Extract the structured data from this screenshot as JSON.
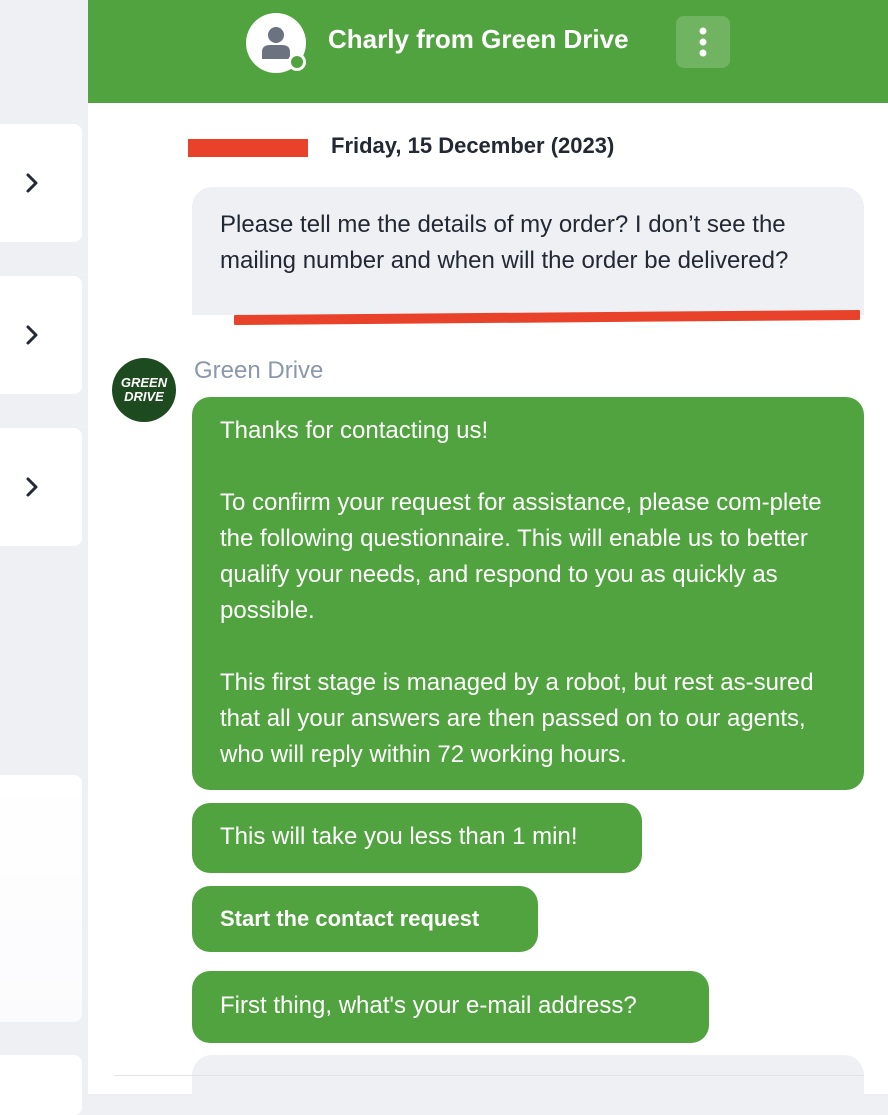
{
  "header": {
    "agent_title": "Charly from Green Drive",
    "brand_color": "#51a33f"
  },
  "conversation": {
    "date_label": "Friday, 15 December (2023)",
    "user_message": "Please tell me the details of my order? I don’t see the mailing number and when will the order be delivered?",
    "bot_name": "Green Drive",
    "bot_avatar_text": [
      "GREEN",
      "DRIVE"
    ],
    "bot_messages": {
      "intro_1": "Thanks for contacting us!",
      "intro_2": "To confirm your request for assistance, please com-plete the following questionnaire. This will enable us to better qualify your needs, and respond to you as quickly as possible.",
      "intro_3": "This first stage is managed by a robot, but rest as-sured that all your answers are then passed on to our agents, who will reply within 72 working hours.",
      "time_note": "This will take you less than 1 min!",
      "start_button": "Start the contact request",
      "email_question": "First thing, what's your e-mail address?"
    }
  },
  "annotations": {
    "arrow_color": "#e8432a",
    "underline_color": "#e8432a"
  },
  "icons": [
    "user-icon",
    "menu-dots-icon",
    "chevron-right-icon",
    "annotation-arrow-icon"
  ]
}
